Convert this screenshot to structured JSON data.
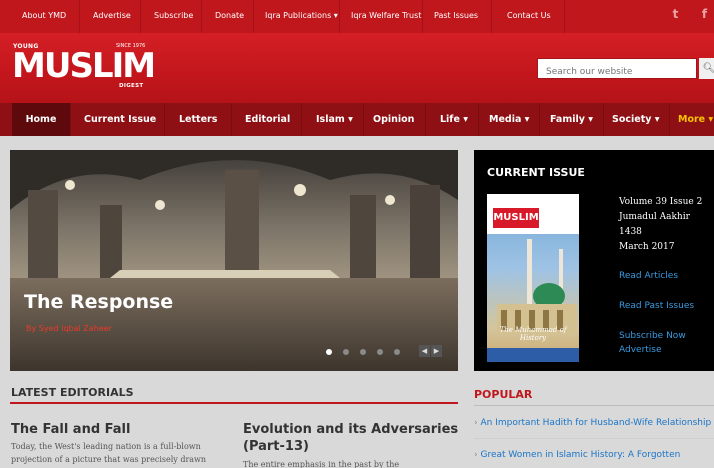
{
  "topbar": {
    "links": [
      "About YMD",
      "Advertise",
      "Subscribe",
      "Donate",
      "Iqra Publications ▾",
      "Iqra Welfare Trust",
      "Past Issues",
      "Contact Us"
    ],
    "social_icons": [
      "twitter-icon",
      "facebook-icon"
    ]
  },
  "logo": {
    "young": "YOUNG",
    "since": "SINCE 1976",
    "muslim": "MUSLIM",
    "digest": "DIGEST"
  },
  "search": {
    "placeholder": "Search our website",
    "button_icon": "search-icon"
  },
  "nav": {
    "items": [
      "Home",
      "Current Issue",
      "Letters",
      "Editorial",
      "Islam ▾",
      "Opinion",
      "Life ▾",
      "Media ▾",
      "Family ▾",
      "Society ▾",
      "More ▾"
    ]
  },
  "slider": {
    "title": "The Response",
    "author": "By Syed Iqbal Zaheer",
    "slides": 5,
    "active_slide": 1
  },
  "current_issue": {
    "heading": "CURRENT ISSUE",
    "volume": "Volume 39 Issue 2",
    "hijri_month": "Jumadul Aakhir",
    "hijri_year": "1438",
    "date": "March 2017",
    "cover_logo": "MUSLIM",
    "cover_title": "The Muhammad of History",
    "links": [
      "Read Articles",
      "Read Past Issues",
      "Subscribe Now",
      "Advertise"
    ]
  },
  "editorials": {
    "heading": "LATEST EDITORIALS",
    "articles": [
      {
        "title": "The Fall and Fall",
        "excerpt": [
          "Today, the West's leading nation is a full-blown",
          "projection of a picture that was precisely drawn"
        ]
      },
      {
        "title": [
          "Evolution and its Adversaries",
          "(Part-13)"
        ],
        "excerpt": [
          "The entire emphasis in the past by the"
        ]
      }
    ]
  },
  "popular": {
    "heading": "POPULAR",
    "items": [
      "An Important Hadith for Husband-Wife Relationship",
      "Great Women in Islamic History: A Forgotten"
    ]
  },
  "colors": {
    "brand_red": "#c0171c",
    "nav_dark": "#8e1014",
    "link_blue": "#1a75c8",
    "more_gold": "#f7c300"
  }
}
